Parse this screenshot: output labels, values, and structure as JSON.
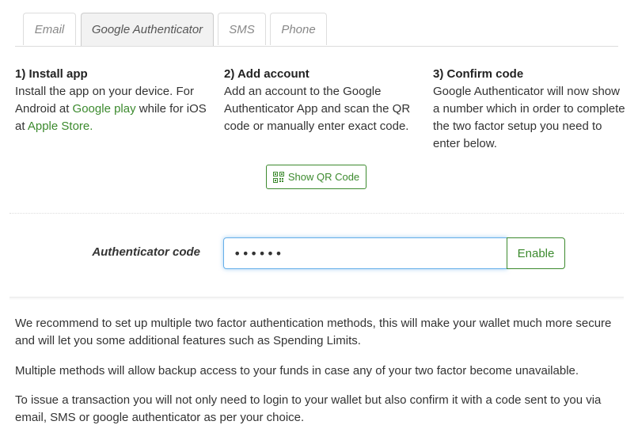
{
  "tabs": [
    {
      "label": "Email"
    },
    {
      "label": "Google Authenticator"
    },
    {
      "label": "SMS"
    },
    {
      "label": "Phone"
    }
  ],
  "active_tab": "Google Authenticator",
  "steps": {
    "install": {
      "title": "1) Install app",
      "text_before": "Install the app on your device. For Android at ",
      "link1": "Google play",
      "text_middle": " while for iOS at ",
      "link2": "Apple Store."
    },
    "add": {
      "title": "2) Add account",
      "text": "Add an account to the Google Authenticator App and scan the QR code or manually enter exact code."
    },
    "confirm": {
      "title": "3) Confirm code",
      "text": "Google Authenticator will now show a number which in order to complete the two factor setup you need to enter below."
    }
  },
  "qr_button": {
    "label": "Show QR Code",
    "icon": "qr-code-icon"
  },
  "form": {
    "label": "Authenticator code",
    "value": "••••••",
    "enable_label": "Enable"
  },
  "info": {
    "p1": "We recommend to set up multiple two factor authentication methods, this will make your wallet much more secure and will let you some additional features such as Spending Limits.",
    "p2": "Multiple methods will allow backup access to your funds in case any of your two factor become unavailable.",
    "p3": "To issue a transaction you will not only need to login to your wallet but also confirm it with a code sent to you via email, SMS or google authenticator as per your choice."
  },
  "colors": {
    "accent": "#3c8a2e",
    "focus": "#66afe9",
    "text": "#333333"
  }
}
